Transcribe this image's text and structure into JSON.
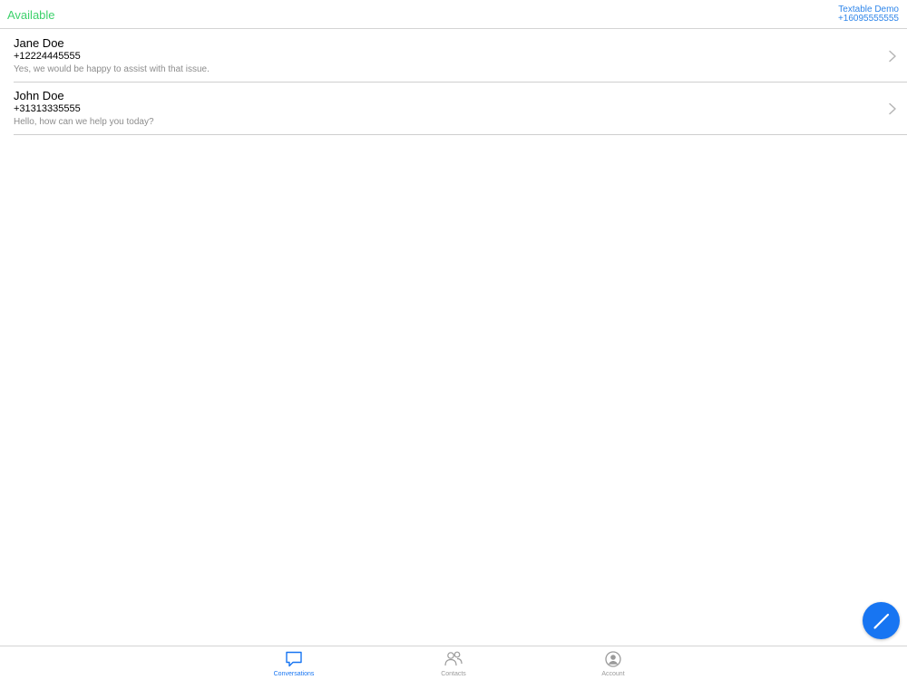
{
  "header": {
    "status": "Available",
    "account_name": "Textable Demo",
    "account_number": "+16095555555"
  },
  "conversations": [
    {
      "name": "Jane Doe",
      "phone": "+12224445555",
      "preview": "Yes, we would be happy to assist with that issue."
    },
    {
      "name": "John Doe",
      "phone": "+31313335555",
      "preview": "Hello, how can we help you today?"
    }
  ],
  "fab": {
    "icon": "compose-pencil-icon"
  },
  "tabs": [
    {
      "label": "Conversations",
      "icon": "chat-bubble-icon",
      "active": true
    },
    {
      "label": "Contacts",
      "icon": "contacts-icon",
      "active": false
    },
    {
      "label": "Account",
      "icon": "account-icon",
      "active": false
    }
  ],
  "colors": {
    "accent": "#1775f2",
    "status_available": "#3dd16b",
    "header_link": "#2f86ea",
    "secondary_text": "#8d8d8d"
  }
}
